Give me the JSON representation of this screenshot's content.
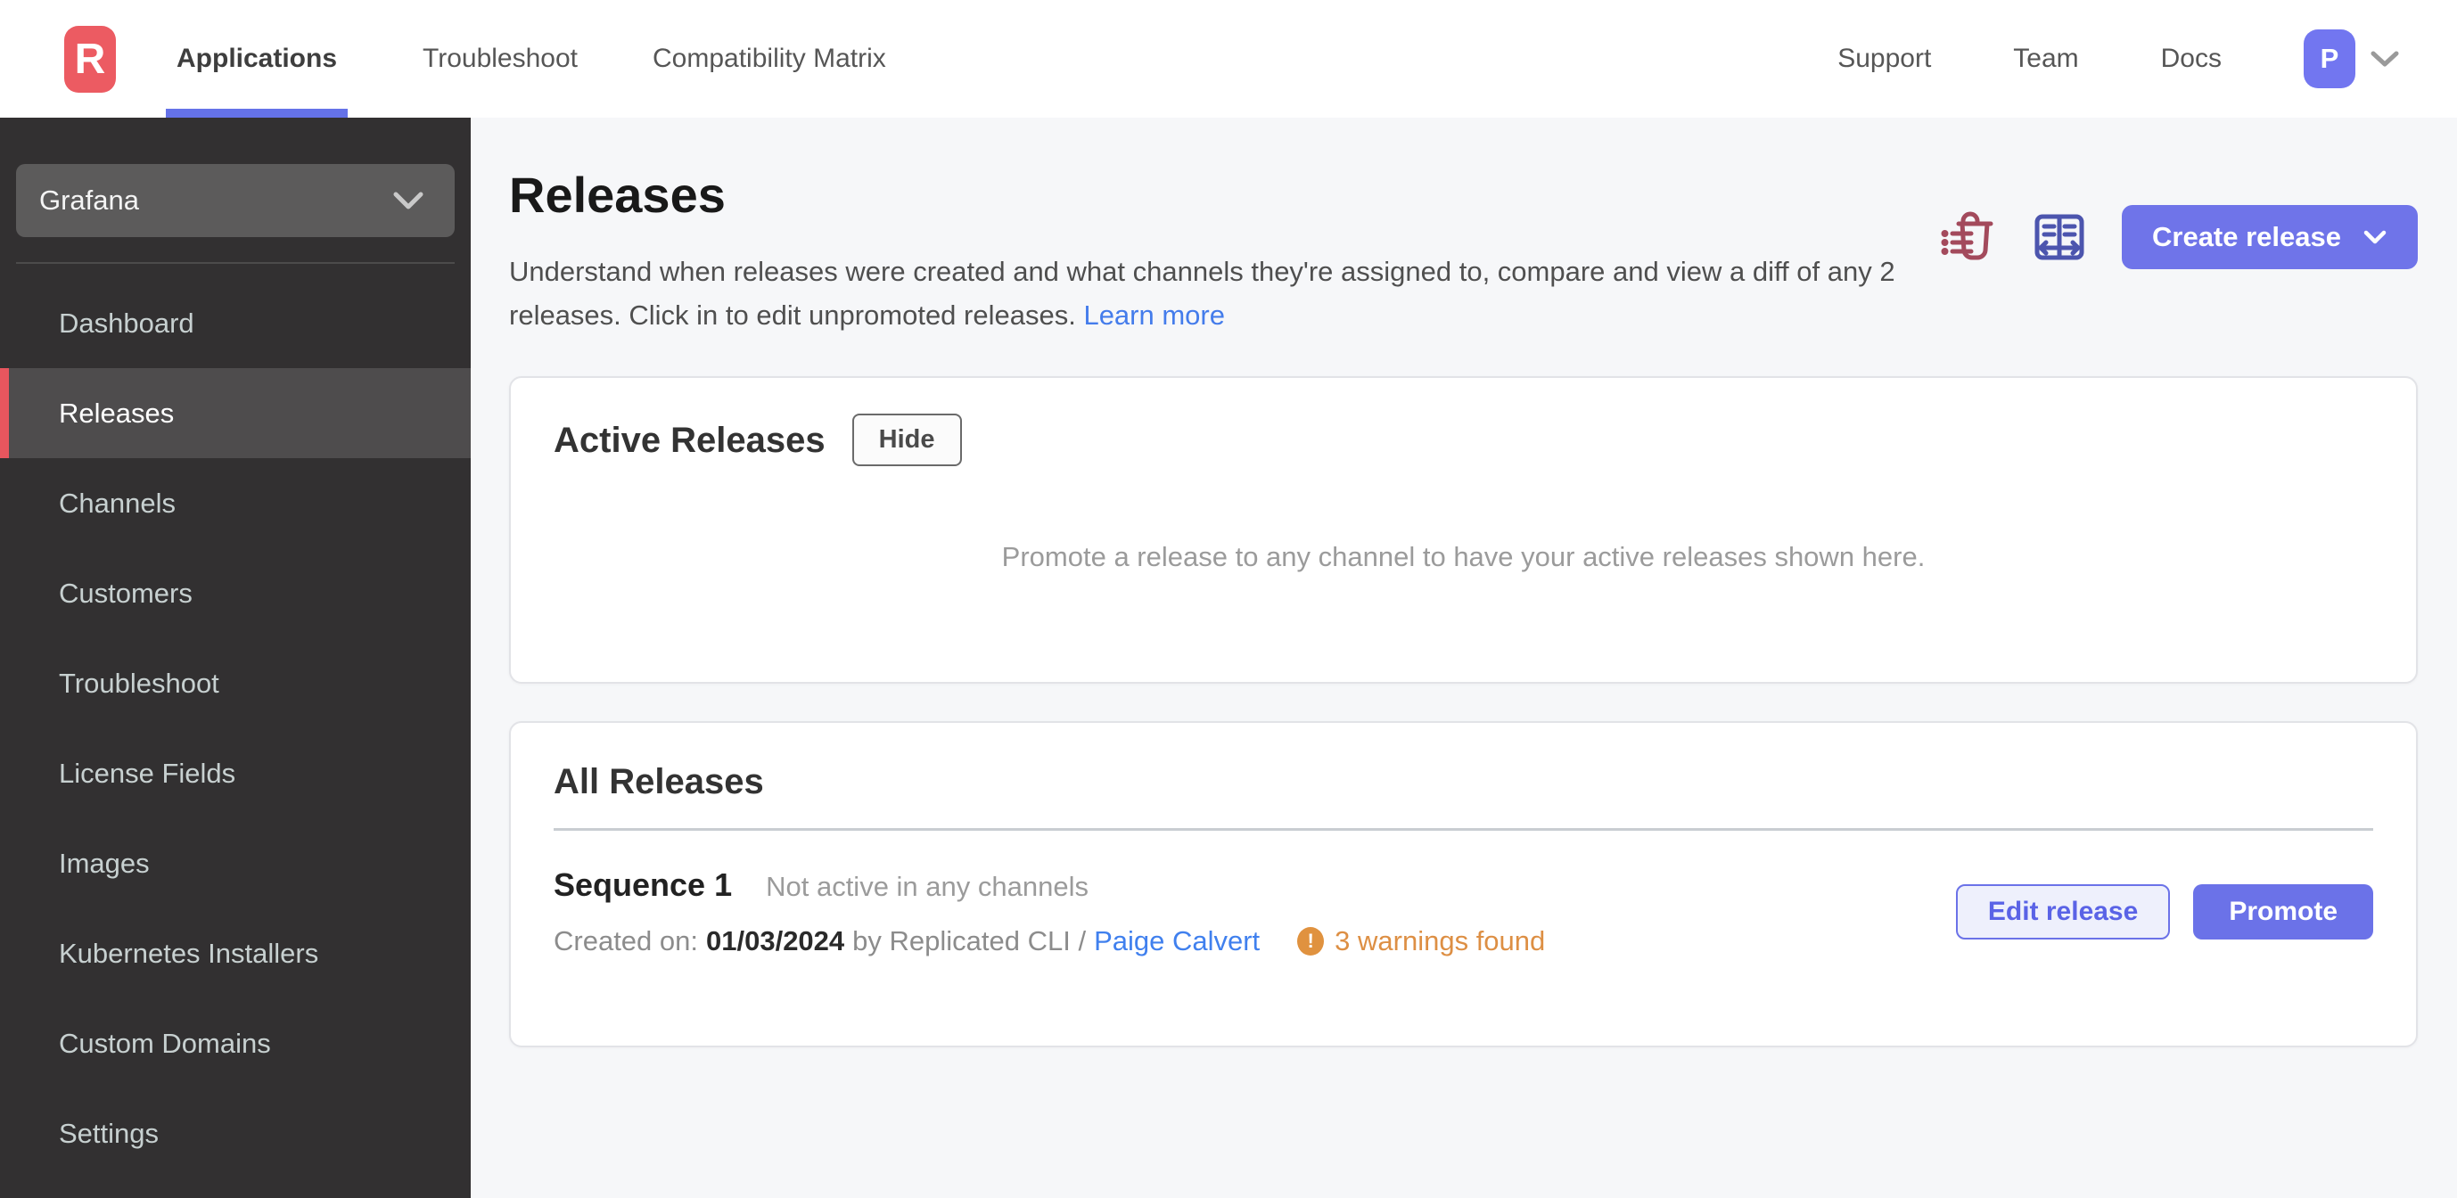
{
  "header": {
    "logo_letter": "R",
    "tabs": [
      {
        "label": "Applications",
        "active": true
      },
      {
        "label": "Troubleshoot",
        "active": false
      },
      {
        "label": "Compatibility Matrix",
        "active": false
      }
    ],
    "links": [
      "Support",
      "Team",
      "Docs"
    ],
    "avatar_initial": "P"
  },
  "sidebar": {
    "app_selector": "Grafana",
    "items": [
      {
        "label": "Dashboard",
        "active": false
      },
      {
        "label": "Releases",
        "active": true
      },
      {
        "label": "Channels",
        "active": false
      },
      {
        "label": "Customers",
        "active": false
      },
      {
        "label": "Troubleshoot",
        "active": false
      },
      {
        "label": "License Fields",
        "active": false
      },
      {
        "label": "Images",
        "active": false
      },
      {
        "label": "Kubernetes Installers",
        "active": false
      },
      {
        "label": "Custom Domains",
        "active": false
      },
      {
        "label": "Settings",
        "active": false
      }
    ]
  },
  "main": {
    "title": "Releases",
    "description": "Understand when releases were created and what channels they're assigned to, compare and view a diff of any 2 releases. Click in to edit unpromoted releases.",
    "learn_more": "Learn more",
    "create_release_label": "Create release",
    "active_releases": {
      "title": "Active Releases",
      "hide_label": "Hide",
      "empty_text": "Promote a release to any channel to have your active releases shown here."
    },
    "all_releases": {
      "title": "All Releases",
      "release": {
        "name": "Sequence 1",
        "status": "Not active in any channels",
        "created_label": "Created on:",
        "created_date": "01/03/2024",
        "created_by": "by Replicated CLI /",
        "author": "Paige Calvert",
        "warning_glyph": "!",
        "warnings": "3 warnings found",
        "edit_label": "Edit release",
        "promote_label": "Promote"
      }
    }
  },
  "colors": {
    "accent_indigo": "#6b72e8",
    "logo_red": "#ec5b62",
    "active_bar_red": "#e8565e",
    "sidebar_bg": "#323031",
    "sidebar_active_bg": "#4e4c4d",
    "link_blue": "#447ceb",
    "warning_orange": "#dd8f44",
    "trash_icon_red": "#a34a5c",
    "diff_icon_indigo": "#4c55ae",
    "main_bg": "#f6f7f9"
  }
}
